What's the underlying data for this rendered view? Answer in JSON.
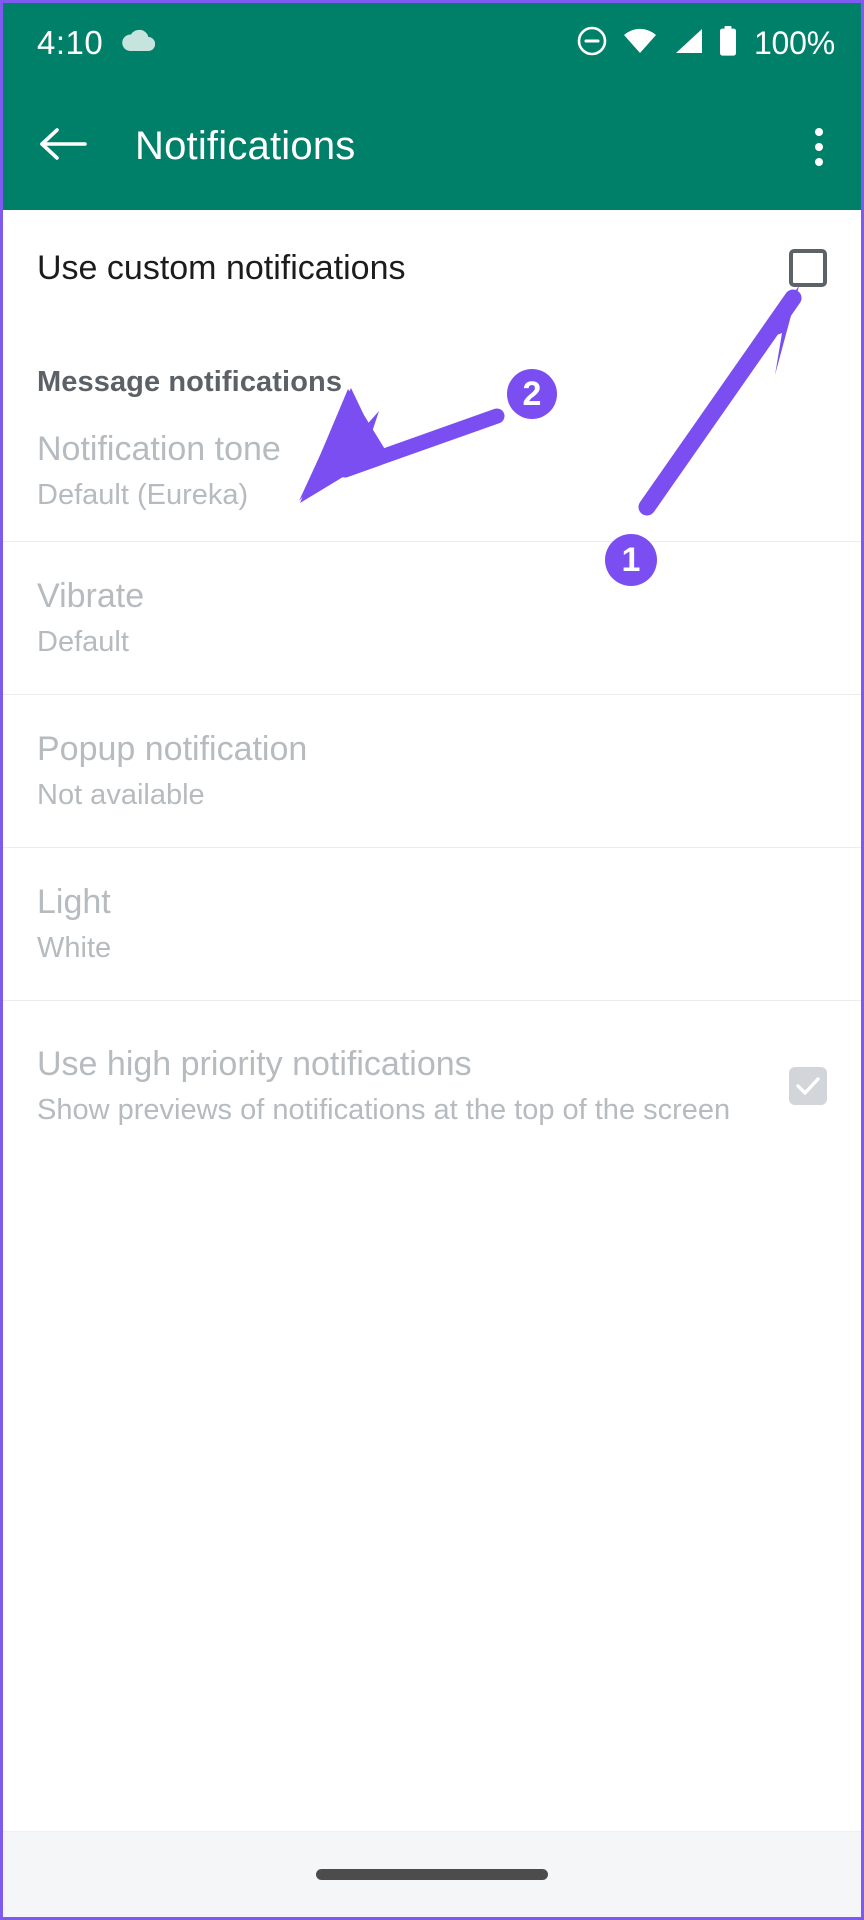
{
  "statusbar": {
    "clock": "4:10",
    "battery_percent": "100%",
    "icons": [
      "cloud-icon",
      "dnd-icon",
      "wifi-icon",
      "cellular-signal-icon",
      "battery-icon"
    ]
  },
  "appbar": {
    "title": "Notifications",
    "back_icon": "arrow-back-icon",
    "overflow_icon": "more-vert-icon"
  },
  "main": {
    "custom_notifications": {
      "label": "Use custom notifications",
      "checked": false
    },
    "section_header": "Message notifications",
    "items": [
      {
        "title": "Notification tone",
        "subtitle": "Default (Eureka)"
      },
      {
        "title": "Vibrate",
        "subtitle": "Default"
      },
      {
        "title": "Popup notification",
        "subtitle": "Not available"
      },
      {
        "title": "Light",
        "subtitle": "White"
      }
    ],
    "high_priority": {
      "title": "Use high priority notifications",
      "subtitle": "Show previews of notifications at the top of the screen",
      "checked": true
    }
  },
  "annotations": {
    "color": "#7a4ef0",
    "badges": [
      {
        "label": "1",
        "target": "use-custom-notifications-checkbox"
      },
      {
        "label": "2",
        "target": "notification-tone-row"
      }
    ]
  },
  "navbar": {
    "gesture_pill": "home-gesture-pill"
  },
  "colors": {
    "header_green": "#008069",
    "accent_purple": "#7a4ef0",
    "disabled_text": "#b6bbbf",
    "primary_text": "#1c1c1c"
  }
}
